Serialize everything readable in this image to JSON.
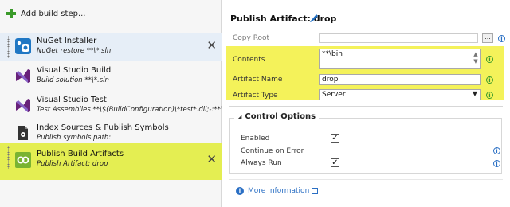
{
  "toolbar": {
    "add_build_step": "Add build step..."
  },
  "steps": [
    {
      "title": "NuGet Installer",
      "subtitle": "NuGet restore **\\*.sln",
      "icon": "nuget-icon",
      "selected": true
    },
    {
      "title": "Visual Studio Build",
      "subtitle": "Build solution **\\*.sln",
      "icon": "visual-studio-icon"
    },
    {
      "title": "Visual Studio Test",
      "subtitle": "Test Assemblies **\\$(BuildConfiguration)\\*test*.dll;-:**\\obj\\**",
      "icon": "visual-studio-icon"
    },
    {
      "title": "Index Sources & Publish Symbols",
      "subtitle": "Publish symbols path:",
      "icon": "symbols-icon"
    },
    {
      "title": "Publish Build Artifacts",
      "subtitle": "Publish Artifact: drop",
      "icon": "publish-artifact-icon",
      "highlighted": true
    }
  ],
  "close_glyph": "✕",
  "detail": {
    "title": "Publish Artifact: drop",
    "fields": {
      "copy_root": {
        "label": "Copy Root",
        "value": ""
      },
      "browse_label": "...",
      "contents": {
        "label": "Contents",
        "value": "**\\bin"
      },
      "artifact_name": {
        "label": "Artifact Name",
        "value": "drop"
      },
      "artifact_type": {
        "label": "Artifact Type",
        "value": "Server"
      }
    },
    "control_options": {
      "title": "Control Options",
      "enabled": {
        "label": "Enabled",
        "checked": true
      },
      "continue_on_error": {
        "label": "Continue on Error",
        "checked": false
      },
      "always_run": {
        "label": "Always Run",
        "checked": true
      }
    },
    "more_info": "More Information"
  },
  "colors": {
    "highlight": "#e4ee52",
    "field_highlight": "#f4f25a",
    "link": "#2a6fc4",
    "add_icon": "#3a9a2a"
  }
}
